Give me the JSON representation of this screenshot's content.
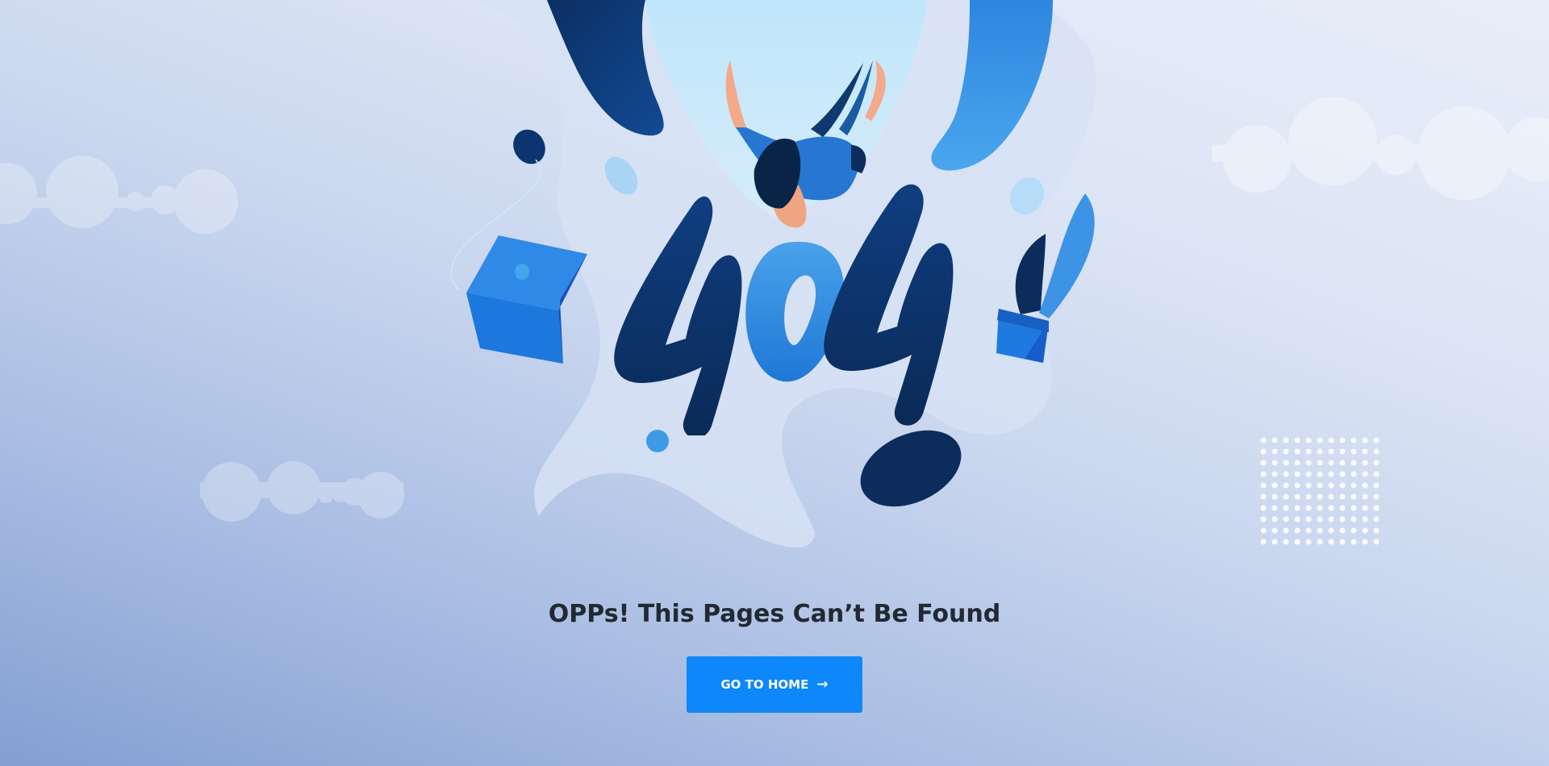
{
  "error": {
    "code": "404",
    "heading": "OPPs! This Pages Can’t Be Found"
  },
  "home_button": {
    "label": "GO TO HOME",
    "icon": "arrow-right-icon",
    "glyph": "→"
  },
  "colors": {
    "accent": "#0d87f9",
    "heading": "#222933",
    "dark_navy": "#0d3a75",
    "light_blue": "#3d9be9"
  }
}
